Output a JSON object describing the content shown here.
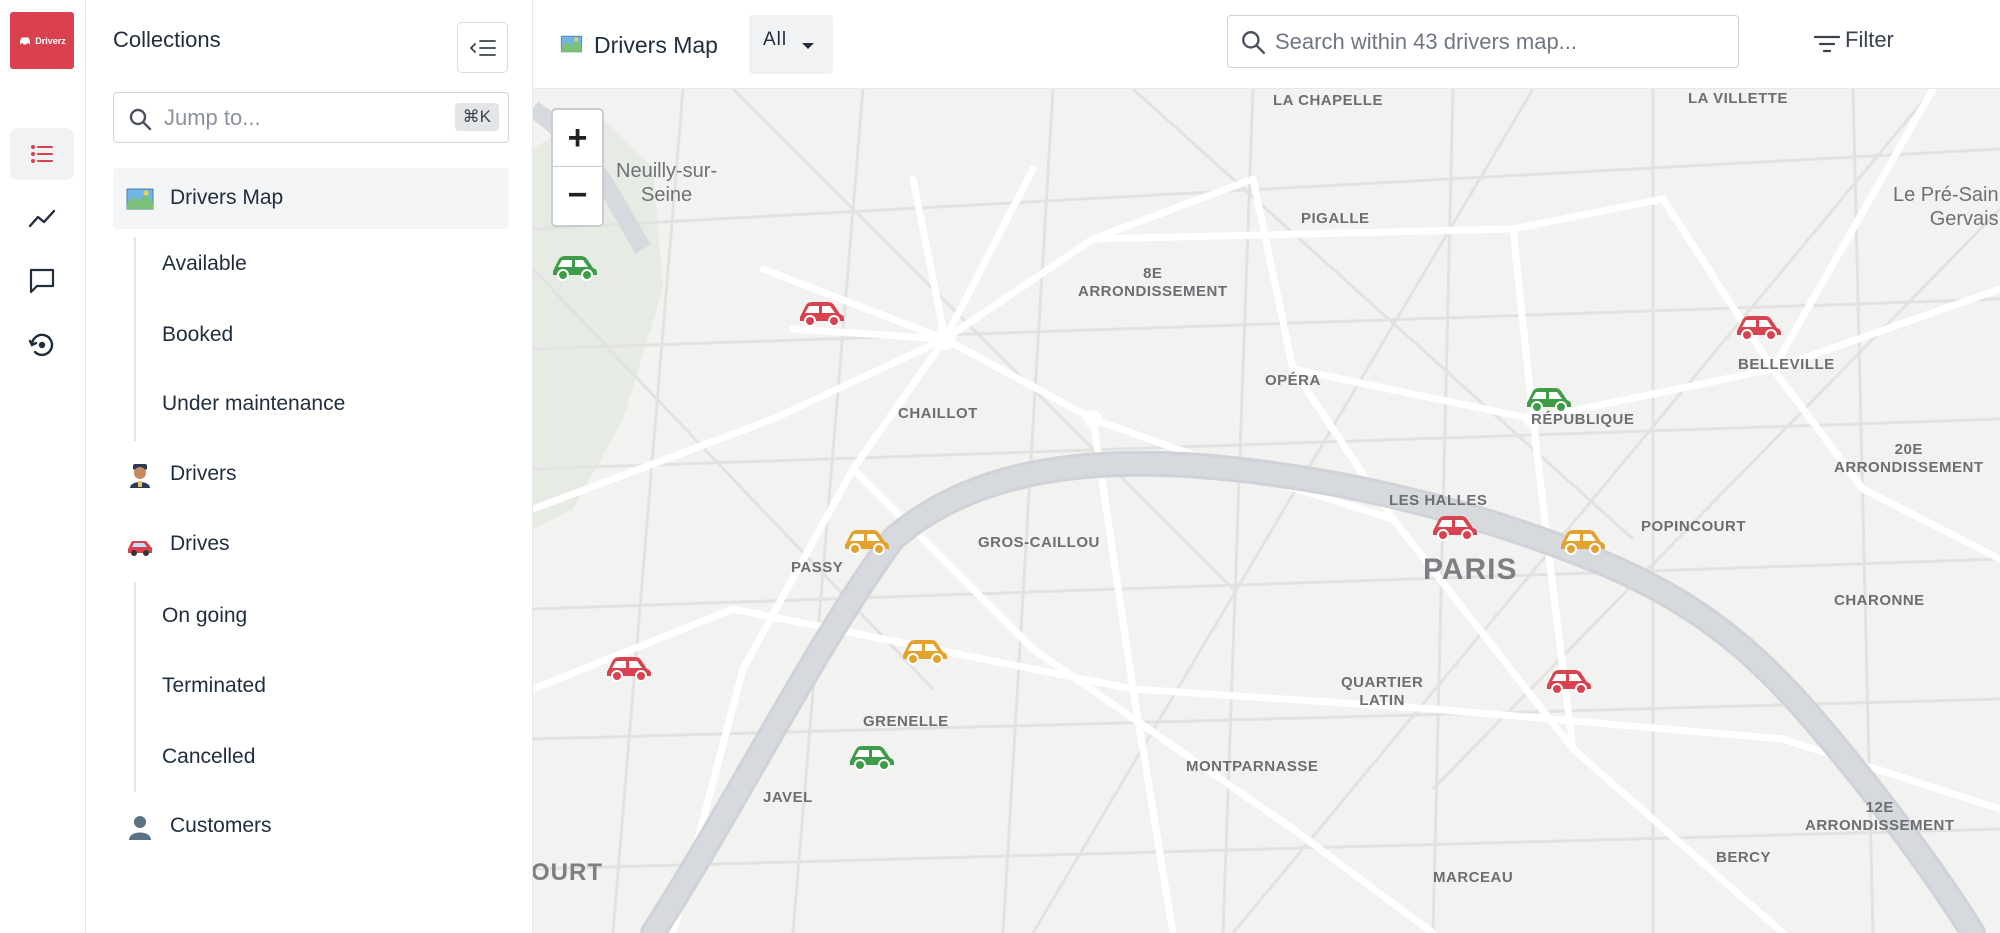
{
  "app": {
    "logo_text": "Driverz",
    "brand_color": "#d9414f"
  },
  "rail": {
    "items": [
      {
        "icon": "list-icon",
        "active": true
      },
      {
        "icon": "chart-line-icon",
        "active": false
      },
      {
        "icon": "chat-icon",
        "active": false
      },
      {
        "icon": "history-icon",
        "active": false
      }
    ]
  },
  "sidebar": {
    "title": "Collections",
    "jump_placeholder": "Jump to...",
    "jump_shortcut": "⌘K",
    "items": [
      {
        "label": "Drivers Map",
        "icon": "map-emoji",
        "selected": true
      },
      {
        "label": "Available"
      },
      {
        "label": "Booked"
      },
      {
        "label": "Under maintenance"
      },
      {
        "label": "Drivers",
        "icon": "driver-emoji"
      },
      {
        "label": "Drives",
        "icon": "car-emoji"
      },
      {
        "label": "On going"
      },
      {
        "label": "Terminated"
      },
      {
        "label": "Cancelled"
      },
      {
        "label": "Customers",
        "icon": "customer-emoji"
      }
    ]
  },
  "header": {
    "title": "Drivers Map",
    "scope_select": "All",
    "search_placeholder": "Search within 43 drivers map...",
    "filter_label": "Filter"
  },
  "map": {
    "zoom_in": "+",
    "zoom_out": "−",
    "labels": {
      "la_chapelle": "LA CHAPELLE",
      "la_villette": "LA VILLETTE",
      "neuilly": "Neuilly-sur-\nSeine",
      "pre_saint_gervais": "Le Pré-Sain\nGervais",
      "pigalle": "PIGALLE",
      "arr8": "8E\nARRONDISSEMENT",
      "opera": "OPÉRA",
      "chaillot": "CHAILLOT",
      "republique": "RÉPUBLIQUE",
      "belleville": "BELLEVILLE",
      "arr20": "20E\nARRONDISSEMENT",
      "les_halles": "LES HALLES",
      "popincourt": "POPINCOURT",
      "gros_caillou": "GROS-CAILLOU",
      "passy": "PASSY",
      "paris": "PARIS",
      "charonne": "CHARONNE",
      "quartier_latin": "QUARTIER\nLATIN",
      "grenelle": "GRENELLE",
      "montparnasse": "MONTPARNASSE",
      "javel": "JAVEL",
      "arr12": "12E\nARRONDISSEMENT",
      "bercy": "BERCY",
      "court": "OURT",
      "marceau": "MARCEAU"
    },
    "status_colors": {
      "available": "#3e9b47",
      "booked": "#d8434f",
      "maintenance": "#e3a22f"
    },
    "markers": [
      {
        "status": "available"
      },
      {
        "status": "booked"
      },
      {
        "status": "booked"
      },
      {
        "status": "available"
      },
      {
        "status": "booked"
      },
      {
        "status": "maintenance"
      },
      {
        "status": "maintenance"
      },
      {
        "status": "maintenance"
      },
      {
        "status": "booked"
      },
      {
        "status": "booked"
      },
      {
        "status": "available"
      }
    ]
  }
}
